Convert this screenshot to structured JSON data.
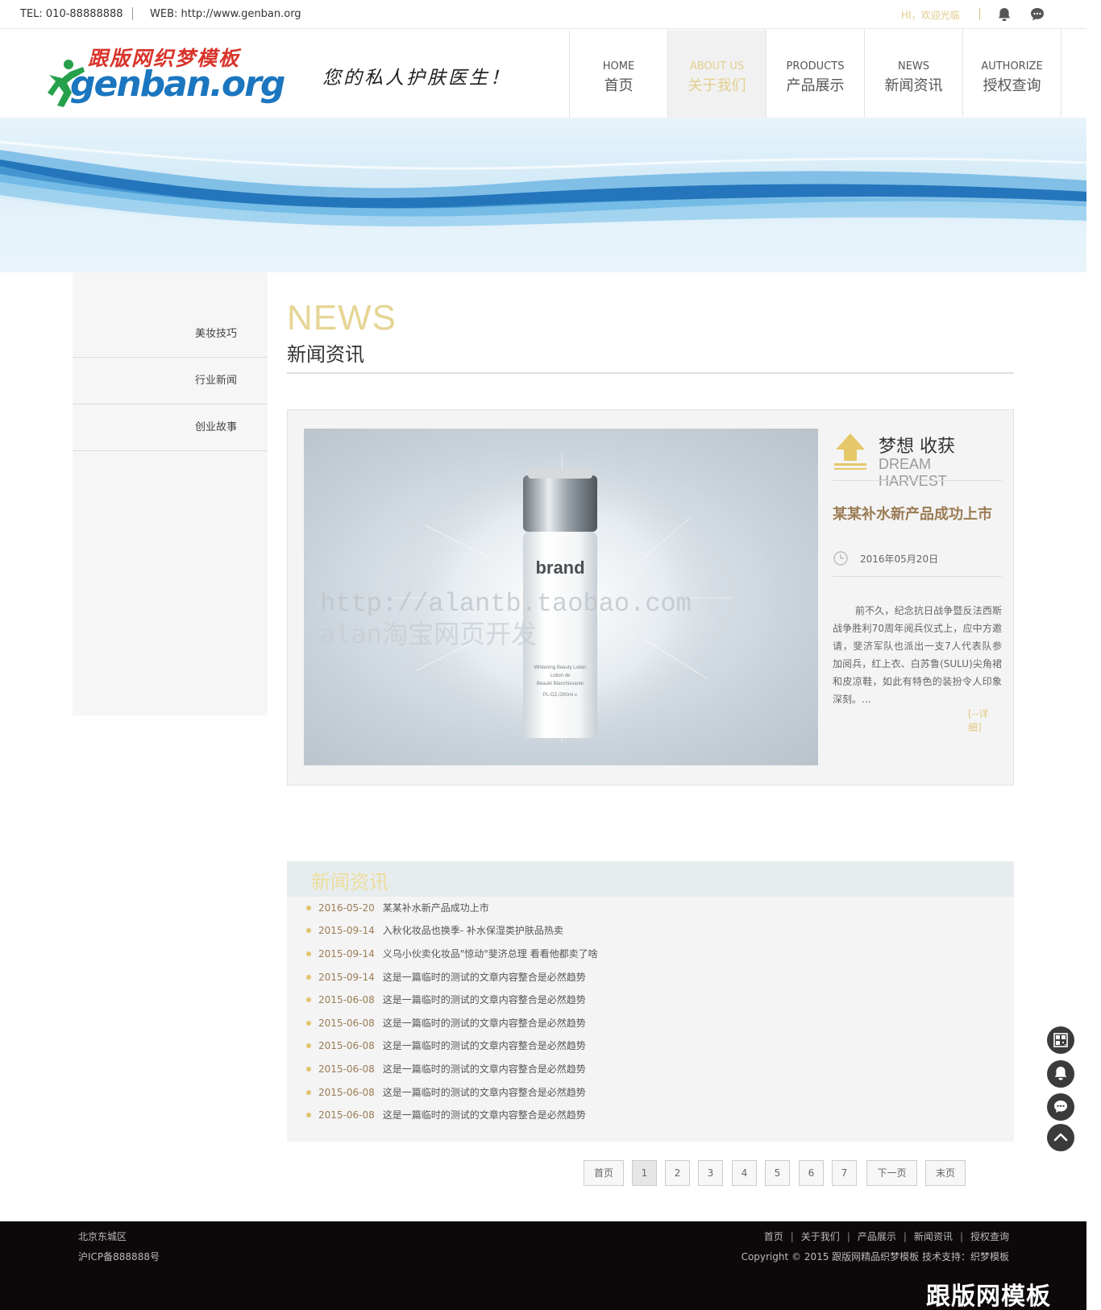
{
  "topbar": {
    "tel": "TEL: 010-88888888",
    "web": "WEB: http://www.genban.org",
    "greeting": "HI，欢迎光临"
  },
  "header": {
    "logo_cn": "跟版网织梦模板",
    "logo_en": "genban.org",
    "slogan": "您的私人护肤医生！"
  },
  "nav": [
    {
      "en": "HOME",
      "cn": "首页"
    },
    {
      "en": "ABOUT US",
      "cn": "关于我们"
    },
    {
      "en": "PRODUCTS",
      "cn": "产品展示"
    },
    {
      "en": "NEWS",
      "cn": "新闻资讯"
    },
    {
      "en": "AUTHORIZE",
      "cn": "授权查询"
    }
  ],
  "sidebar": {
    "items": [
      "美妆技巧",
      "行业新闻",
      "创业故事"
    ]
  },
  "main": {
    "heading_en": "NEWS",
    "heading_cn": "新闻资讯"
  },
  "featured": {
    "badge_zh": "梦想 收获",
    "badge_en": "DREAM HARVEST",
    "title": "某某补水新产品成功上市",
    "date": "2016年05月20日",
    "description": "前不久，纪念抗日战争暨反法西斯战争胜利70周年阅兵仪式上，应中方邀请，斐济军队也派出一支7人代表队参加阅兵，红上衣、白苏鲁(SULU)尖角裙和皮凉鞋，如此有特色的装扮令人印象深刻。...",
    "more": "[--详细]",
    "image_text": {
      "brand": "brand",
      "product": "Whitening Beauty Lotion",
      "product_fr1": "Lotion de",
      "product_fr2": "Beauté Blanchissante",
      "volume": "PL-OZ./200ml ℮",
      "watermark1": "http://alantb.taobao.com",
      "watermark2": "alan淘宝网页开发"
    }
  },
  "list": {
    "title": "新闻资讯",
    "items": [
      {
        "date": "2016-05-20",
        "title": "某某补水新产品成功上市"
      },
      {
        "date": "2015-09-14",
        "title": "入秋化妆品也换季- 补水保湿类护肤品热卖"
      },
      {
        "date": "2015-09-14",
        "title": "义乌小伙卖化妆品\"惊动\"斐济总理 看看他都卖了啥"
      },
      {
        "date": "2015-09-14",
        "title": "这是一篇临时的测试的文章内容整合是必然趋势"
      },
      {
        "date": "2015-06-08",
        "title": "这是一篇临时的测试的文章内容整合是必然趋势"
      },
      {
        "date": "2015-06-08",
        "title": "这是一篇临时的测试的文章内容整合是必然趋势"
      },
      {
        "date": "2015-06-08",
        "title": "这是一篇临时的测试的文章内容整合是必然趋势"
      },
      {
        "date": "2015-06-08",
        "title": "这是一篇临时的测试的文章内容整合是必然趋势"
      },
      {
        "date": "2015-06-08",
        "title": "这是一篇临时的测试的文章内容整合是必然趋势"
      },
      {
        "date": "2015-06-08",
        "title": "这是一篇临时的测试的文章内容整合是必然趋势"
      }
    ]
  },
  "pager": {
    "first": "首页",
    "pages": [
      "1",
      "2",
      "3",
      "4",
      "5",
      "6",
      "7"
    ],
    "current": "1",
    "next": "下一页",
    "last": "末页"
  },
  "footer": {
    "address": "北京东城区",
    "icp": "沪ICP备888888号",
    "links": [
      "首页",
      "关于我们",
      "产品展示",
      "新闻资讯",
      "授权查询"
    ],
    "copyright": "Copyright © 2015 跟版网精品织梦模板 技术支持：织梦模板",
    "watermark": "跟版网模板"
  },
  "colors": {
    "accent_gold": "#e3cf8f",
    "title_brown": "#9b7c55",
    "logo_red": "#d9342b",
    "logo_blue": "#1b76bf",
    "footer_bg": "#0d090b"
  },
  "icons": [
    "bell-icon",
    "chat-icon",
    "qrcode-icon",
    "back-to-top-icon",
    "clock-icon",
    "arrow-up-icon"
  ]
}
